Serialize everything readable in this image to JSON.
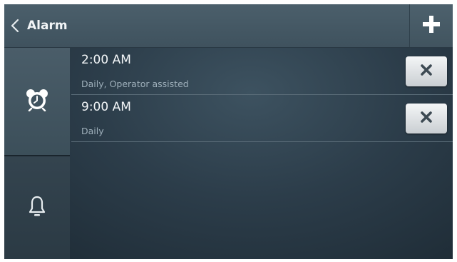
{
  "header": {
    "title": "Alarm",
    "back_icon": "chevron-left-icon",
    "add_icon": "plus-icon"
  },
  "sidebar": {
    "tabs": [
      {
        "icon": "alarm-clock-icon",
        "active": true
      },
      {
        "icon": "bell-icon",
        "active": false
      }
    ]
  },
  "alarms": [
    {
      "time": "2:00 AM",
      "details": "Daily, Operator assisted"
    },
    {
      "time": "9:00 AM",
      "details": "Daily"
    }
  ],
  "colors": {
    "background": "#2c3d4a",
    "topbar": "#455965",
    "text_primary": "#f3f6f8",
    "text_secondary": "#9fb0bb",
    "delete_button": "#e4e7ea"
  }
}
